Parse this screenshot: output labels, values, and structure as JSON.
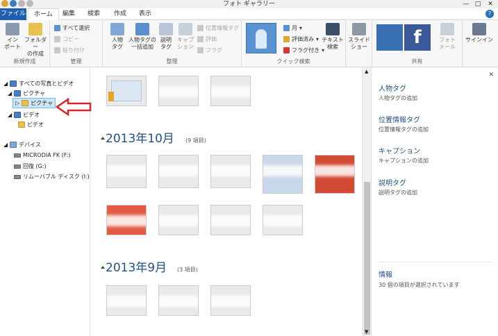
{
  "window": {
    "title": "フォト ギャラリー",
    "minimize": "—",
    "maximize": "□",
    "close": "✕"
  },
  "tabs": {
    "file": "ファイル",
    "home": "ホーム",
    "edit": "編集",
    "search": "検索",
    "create": "作成",
    "view": "表示",
    "help": "?"
  },
  "ribbon": {
    "new_group": {
      "label": "新規作成",
      "import": "イン\nポート",
      "create_folder": "フォルダー\nの作成"
    },
    "manage_group": {
      "label": "管理",
      "select_all": "すべて選択",
      "copy": "コピー",
      "paste": "貼り付け"
    },
    "organize_group": {
      "label": "整理",
      "people_tag": "人物\nタグ",
      "batch_people": "人物タグの\n一括追加",
      "descriptive_tag": "説明\nタグ",
      "caption": "キャプ\nション",
      "geotag": "位置情報タグ",
      "rating": "評価",
      "flag": "フラグ"
    },
    "quickfind_group": {
      "label": "クイック検索",
      "month": "月",
      "rated": "評価済み",
      "flagged": "フラグ付き",
      "text_search": "テキスト\n検索"
    },
    "slideshow": "スライド\nショー",
    "share_group": {
      "label": "共有",
      "photo_mail": "フォト\nメール"
    },
    "signin": "サインイン"
  },
  "navigation": {
    "all_photos": "すべての写真とビデオ",
    "pictures": "ピクチャ",
    "pictures_sub": "ピクチャ",
    "videos": "ビデオ",
    "videos_sub": "ビデオ",
    "devices": "デバイス",
    "device1": "MICRODIA FK (F:)",
    "device2": "回復 (G:)",
    "device3": "リムーバブル ディスク (I:)"
  },
  "groups": [
    {
      "title": "2013年10月",
      "count": "(9 項目)"
    },
    {
      "title": "2013年9月",
      "count": "(3 項目)"
    }
  ],
  "info_pane": {
    "people_tag": "人物タグ",
    "people_tag_sub": "人物タグの追加",
    "geotag": "位置情報タグ",
    "geotag_sub": "位置情報タグの追加",
    "caption": "キャプション",
    "caption_sub": "キャプションの追加",
    "desc_tag": "説明タグ",
    "desc_tag_sub": "説明タグの追加",
    "info": "情報",
    "info_sub": "30 個の項目が選択されています",
    "close": "✕"
  },
  "colors": {
    "file_tab": "#1e5fae",
    "group_title": "#1f4f8b",
    "selection": "#cde6f7",
    "arrow": "#d9232a"
  }
}
